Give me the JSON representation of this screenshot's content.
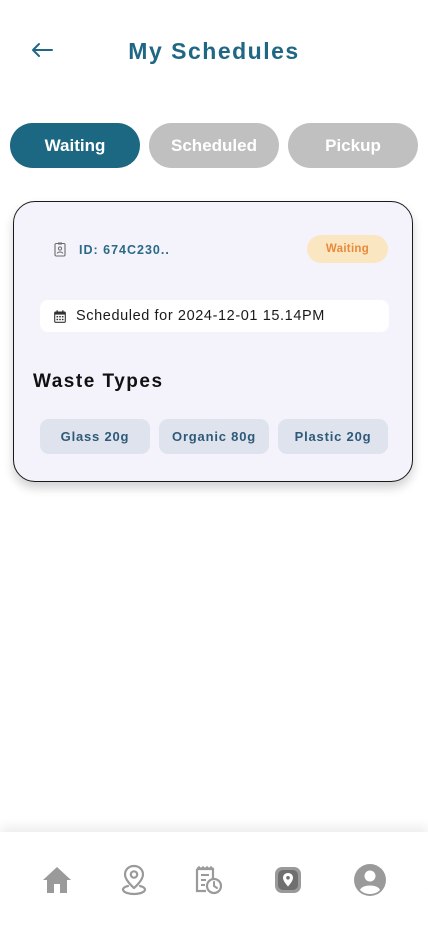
{
  "header": {
    "title": "My Schedules",
    "back_icon": "back-arrow-icon"
  },
  "tabs": [
    {
      "label": "Waiting",
      "active": true
    },
    {
      "label": "Scheduled",
      "active": false
    },
    {
      "label": "Pickup",
      "active": false
    }
  ],
  "schedule_card": {
    "id_label": "ID: 674C230..",
    "status": "Waiting",
    "scheduled_text": "Scheduled for 2024-12-01 15.14PM",
    "section_title": "Waste Types",
    "waste_types": [
      {
        "label": "Glass 20g"
      },
      {
        "label": "Organic 80g"
      },
      {
        "label": "Plastic 20g"
      }
    ]
  },
  "bottom_nav": {
    "items": [
      {
        "icon": "home-icon"
      },
      {
        "icon": "map-pin-icon"
      },
      {
        "icon": "schedule-history-icon"
      },
      {
        "icon": "location-badge-icon"
      },
      {
        "icon": "profile-icon"
      }
    ]
  },
  "colors": {
    "primary": "#1c6883",
    "tab_inactive": "#c0c0c0",
    "card_bg": "#f4f2fa",
    "badge_bg": "#fbe6c2",
    "badge_text": "#e88a3a",
    "chip_bg": "#dfe3ee",
    "icon_gray": "#9a9a9a"
  }
}
